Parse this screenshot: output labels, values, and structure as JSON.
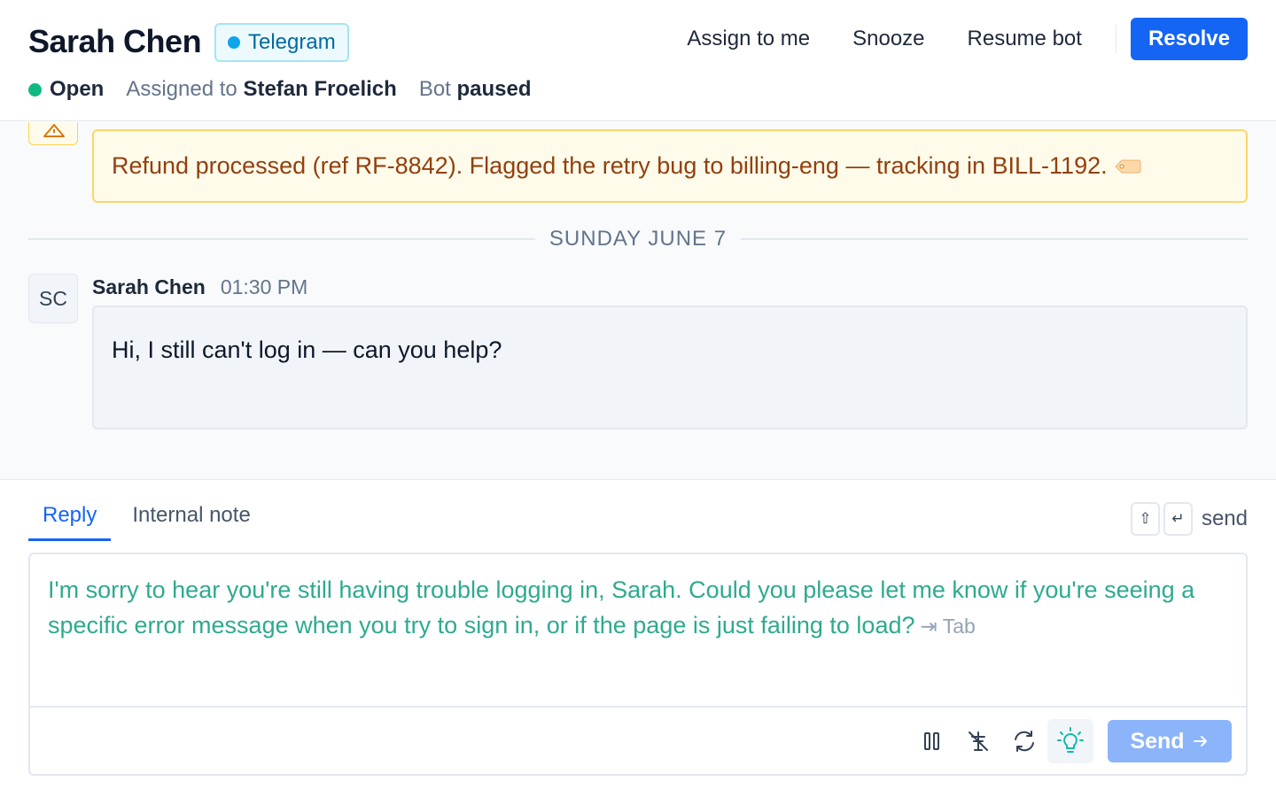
{
  "header": {
    "title": "Sarah Chen",
    "channel": "Telegram",
    "actions": {
      "assign": "Assign to me",
      "snooze": "Snooze",
      "resume_bot": "Resume bot",
      "resolve": "Resolve"
    },
    "meta": {
      "status": "Open",
      "assigned_prefix": "Assigned to",
      "assignee": "Stefan Froelich",
      "bot_prefix": "Bot",
      "bot_state": "paused"
    }
  },
  "conversation": {
    "note_text": "Refund processed (ref RF-8842). Flagged the retry bug to billing-eng — tracking in BILL-1192.",
    "note_icon": "warning-icon",
    "date_divider": "SUNDAY JUNE 7",
    "message": {
      "initials": "SC",
      "author": "Sarah Chen",
      "time": "01:30 PM",
      "text": "Hi, I still can't log in — can you help?"
    }
  },
  "composer": {
    "tabs": [
      "Reply",
      "Internal note"
    ],
    "active_tab": "Reply",
    "shortcut_keys": [
      "⇧",
      "↵"
    ],
    "shortcut_label": "send",
    "suggestion": "I'm sorry to hear you're still having trouble logging in, Sarah. Could you please let me know if you're seeing a specific error message when you try to sign in, or if the page is just failing to load?",
    "tab_hint": "⇥ Tab",
    "tools": [
      "pause-icon",
      "no-signal-icon",
      "refresh-icon",
      "lightbulb-icon"
    ],
    "send_label": "Send"
  },
  "colors": {
    "accent": "#1565f5",
    "open_status": "#10b981",
    "channel": "#0ea5e9",
    "suggestion_text": "#2eaa8f",
    "note_text": "#92400e"
  }
}
